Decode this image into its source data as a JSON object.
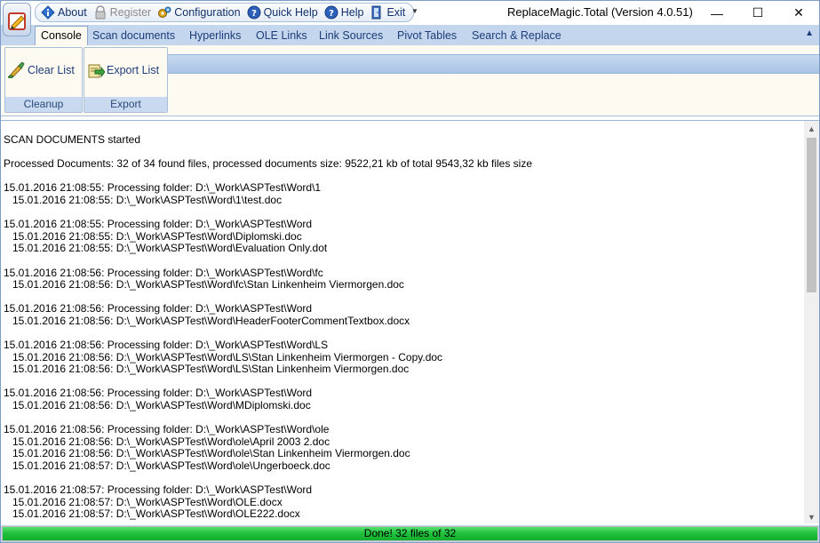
{
  "window": {
    "title": "ReplaceMagic.Total (Version 4.0.51)",
    "minimize": "—",
    "maximize": "☐",
    "close": "✕"
  },
  "quick_access": {
    "about": "About",
    "register": "Register",
    "configuration": "Configuration",
    "quick_help": "Quick Help",
    "help": "Help",
    "exit": "Exit"
  },
  "tabs": [
    {
      "label": "Console",
      "active": true
    },
    {
      "label": "Scan documents"
    },
    {
      "label": "Hyperlinks"
    },
    {
      "label": "OLE Links"
    },
    {
      "label": "Link Sources"
    },
    {
      "label": "Pivot Tables"
    },
    {
      "label": "Search & Replace"
    }
  ],
  "ribbon": {
    "cleanup": {
      "button": "Clear List",
      "label": "Cleanup"
    },
    "export": {
      "button": "Export List",
      "label": "Export"
    }
  },
  "console_lines": [
    "SCAN DOCUMENTS started",
    "",
    "Processed Documents: 32 of 34 found files, processed documents size: 9522,21 kb of total 9543,32 kb files size",
    "",
    "15.01.2016 21:08:55: Processing folder: D:\\_Work\\ASPTest\\Word\\1",
    "   15.01.2016 21:08:55: D:\\_Work\\ASPTest\\Word\\1\\test.doc",
    "",
    "15.01.2016 21:08:55: Processing folder: D:\\_Work\\ASPTest\\Word",
    "   15.01.2016 21:08:55: D:\\_Work\\ASPTest\\Word\\Diplomski.doc",
    "   15.01.2016 21:08:55: D:\\_Work\\ASPTest\\Word\\Evaluation Only.dot",
    "",
    "15.01.2016 21:08:56: Processing folder: D:\\_Work\\ASPTest\\Word\\fc",
    "   15.01.2016 21:08:56: D:\\_Work\\ASPTest\\Word\\fc\\Stan Linkenheim Viermorgen.doc",
    "",
    "15.01.2016 21:08:56: Processing folder: D:\\_Work\\ASPTest\\Word",
    "   15.01.2016 21:08:56: D:\\_Work\\ASPTest\\Word\\HeaderFooterCommentTextbox.docx",
    "",
    "15.01.2016 21:08:56: Processing folder: D:\\_Work\\ASPTest\\Word\\LS",
    "   15.01.2016 21:08:56: D:\\_Work\\ASPTest\\Word\\LS\\Stan Linkenheim Viermorgen - Copy.doc",
    "   15.01.2016 21:08:56: D:\\_Work\\ASPTest\\Word\\LS\\Stan Linkenheim Viermorgen.doc",
    "",
    "15.01.2016 21:08:56: Processing folder: D:\\_Work\\ASPTest\\Word",
    "   15.01.2016 21:08:56: D:\\_Work\\ASPTest\\Word\\MDiplomski.doc",
    "",
    "15.01.2016 21:08:56: Processing folder: D:\\_Work\\ASPTest\\Word\\ole",
    "   15.01.2016 21:08:56: D:\\_Work\\ASPTest\\Word\\ole\\April 2003 2.doc",
    "   15.01.2016 21:08:56: D:\\_Work\\ASPTest\\Word\\ole\\Stan Linkenheim Viermorgen.doc",
    "   15.01.2016 21:08:57: D:\\_Work\\ASPTest\\Word\\ole\\Ungerboeck.doc",
    "",
    "15.01.2016 21:08:57: Processing folder: D:\\_Work\\ASPTest\\Word",
    "   15.01.2016 21:08:57: D:\\_Work\\ASPTest\\Word\\OLE.docx",
    "   15.01.2016 21:08:57: D:\\_Work\\ASPTest\\Word\\OLE222.docx"
  ],
  "status": {
    "text": "Done! 32 files of 32",
    "progress_fraction": 1.0
  }
}
